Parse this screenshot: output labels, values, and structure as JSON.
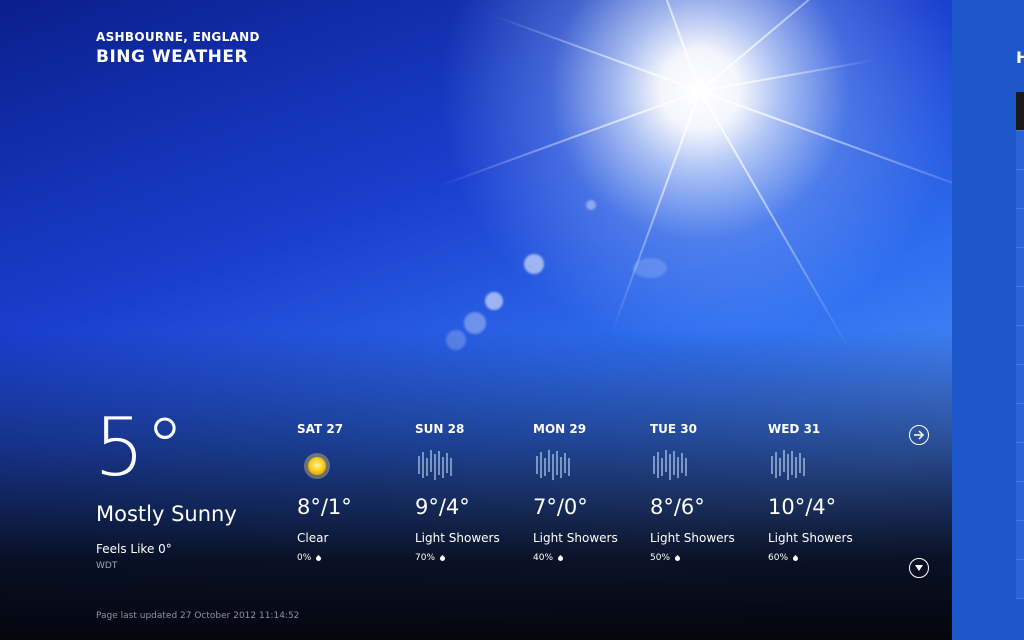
{
  "header": {
    "location": "ASHBOURNE, ENGLAND",
    "app_title": "BING WEATHER"
  },
  "current": {
    "temperature": "5°",
    "condition": "Mostly Sunny",
    "feels_like": "Feels Like 0°",
    "source": "WDT"
  },
  "forecast": [
    {
      "day": "SAT 27",
      "temps": "8°/1°",
      "condition": "Clear",
      "precip": "0%",
      "icon": "sun-icon"
    },
    {
      "day": "SUN 28",
      "temps": "9°/4°",
      "condition": "Light Showers",
      "precip": "70%",
      "icon": "showers-icon"
    },
    {
      "day": "MON 29",
      "temps": "7°/0°",
      "condition": "Light Showers",
      "precip": "40%",
      "icon": "showers-icon"
    },
    {
      "day": "TUE 30",
      "temps": "8°/6°",
      "condition": "Light Showers",
      "precip": "50%",
      "icon": "showers-icon"
    },
    {
      "day": "WED 31",
      "temps": "10°/4°",
      "condition": "Light Showers",
      "precip": "60%",
      "icon": "showers-icon"
    }
  ],
  "footer": {
    "last_updated": "Page last updated 27 October 2012 11:14:52"
  },
  "right_panel": {
    "header_text": "H"
  },
  "icons": {
    "next": "arrow-right-circle-icon",
    "scroll_down": "chevron-down-circle-icon"
  },
  "colors": {
    "right_panel": "#1d57c9",
    "sky": "#2f6ff0"
  }
}
